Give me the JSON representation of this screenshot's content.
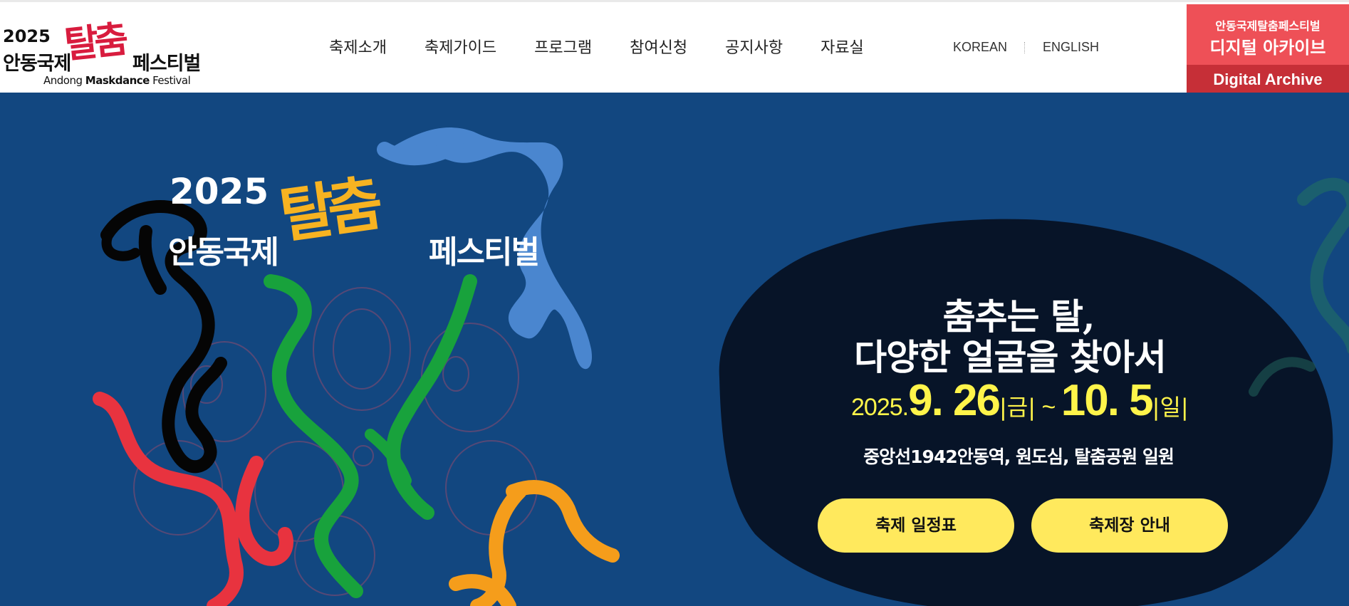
{
  "logo": {
    "year": "2025",
    "ko_left": "안동국제",
    "ko_mark": "탈춤",
    "ko_right": "페스티벌",
    "en_pre": "Andong ",
    "en_bold": "Maskdance",
    "en_post": " Festival"
  },
  "nav": {
    "items": [
      {
        "label": "축제소개"
      },
      {
        "label": "축제가이드"
      },
      {
        "label": "프로그램"
      },
      {
        "label": "참여신청"
      },
      {
        "label": "공지사항"
      },
      {
        "label": "자료실"
      }
    ]
  },
  "lang": {
    "korean": "KOREAN",
    "english": "ENGLISH"
  },
  "archive": {
    "line1": "안동국제탈춤페스티벌",
    "line2": "디지털 아카이브",
    "line3": "Digital Archive"
  },
  "hero": {
    "logo_year": "2025",
    "logo_ko_left": "안동국제",
    "logo_ko_mark": "탈춤",
    "logo_ko_right": "페스티벌",
    "tagline1": "춤추는 탈,",
    "tagline2": "다양한 얼굴을 찾아서",
    "date_year": "2025.",
    "date_start": "9. 26",
    "date_start_day": "|금|",
    "date_tilde": " ~ ",
    "date_end": "10. 5",
    "date_end_day": "|일|",
    "venue": "중앙선1942안동역, 원도심, 탈춤공원 일원",
    "btn_schedule": "축제 일정표",
    "btn_map": "축제장 안내"
  },
  "colors": {
    "hero_bg": "#124780",
    "oval": "#071428",
    "accent_yellow": "#fff44a",
    "button_yellow": "#ffe95d",
    "archive_red": "#ee5057",
    "archive_dark_red": "#c62f37",
    "logo_red": "#d81c3e",
    "logo_orange": "#f7b321"
  }
}
